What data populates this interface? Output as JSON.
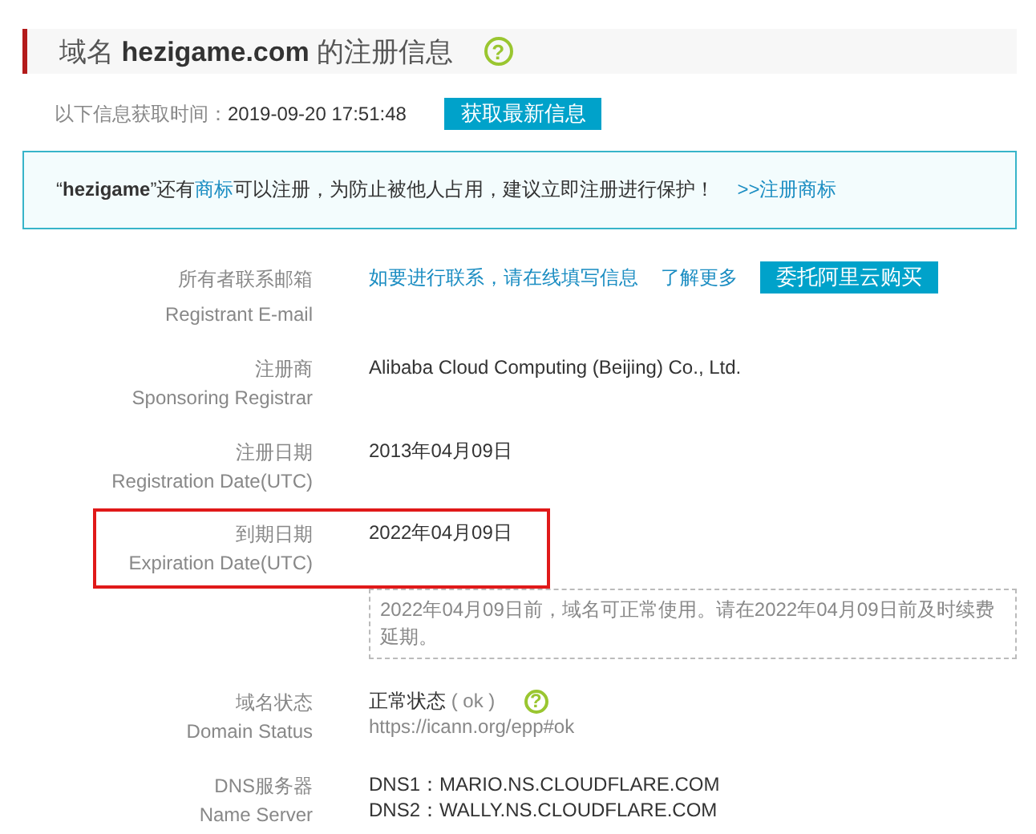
{
  "header": {
    "prefix": "域名",
    "domain": "hezigame.com",
    "suffix": "的注册信息",
    "help": "?"
  },
  "fetch": {
    "label": "以下信息获取时间：",
    "time": "2019-09-20 17:51:48",
    "button": "获取最新信息"
  },
  "notice": {
    "before": "“**hezigame**”还有",
    "link": "商标",
    "after": "可以注册，为防止被他人占用，建议立即注册进行保护！",
    "action": ">>注册商标"
  },
  "records": [
    {
      "kind": "contact",
      "label": "所有者联系邮箱",
      "label_en": "Registrant E-mail",
      "highlighted": false,
      "links": [
        "如要进行联系，请在线填写信息",
        "了解更多"
      ],
      "button": "委托阿里云购买"
    },
    {
      "kind": "text",
      "label": "注册商",
      "label_en": "Sponsoring Registrar",
      "highlighted": false,
      "lines": [
        "Alibaba Cloud Computing (Beijing) Co., Ltd."
      ]
    },
    {
      "kind": "text",
      "label": "注册日期",
      "label_en": "Registration Date(UTC)",
      "highlighted": false,
      "lines": [
        "2013年04月09日"
      ]
    },
    {
      "kind": "text",
      "label": "到期日期",
      "label_en": "Expiration Date(UTC)",
      "highlighted": true,
      "lines": [
        "2022年04月09日"
      ],
      "note": "2022年04月09日前，域名可正常使用。请在2022年04月09日前及时续费延期。"
    },
    {
      "kind": "status",
      "label": "域名状态",
      "label_en": "Domain Status",
      "highlighted": false,
      "status": "正常状态",
      "code": "( ok )",
      "help": "?",
      "url": "https://icann.org/epp#ok"
    },
    {
      "kind": "text",
      "label": "DNS服务器",
      "label_en": "Name Server",
      "highlighted": false,
      "lines": [
        "DNS1：MARIO.NS.CLOUDFLARE.COM",
        "DNS2：WALLY.NS.CLOUDFLARE.COM"
      ]
    }
  ]
}
